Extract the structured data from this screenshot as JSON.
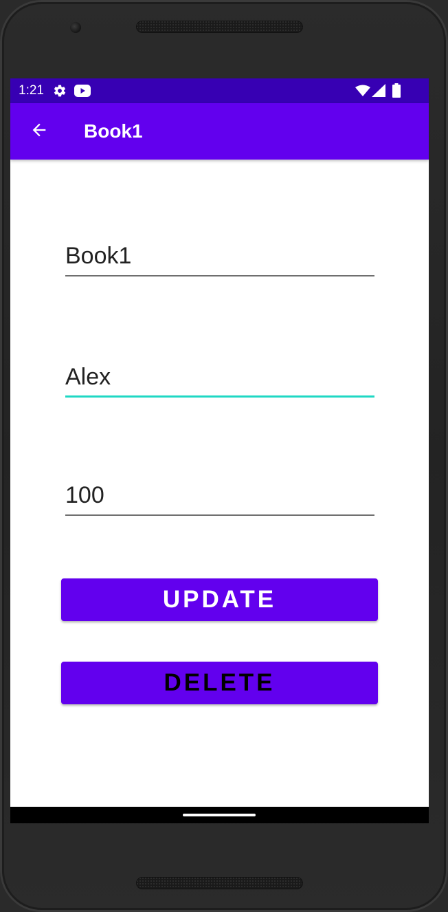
{
  "status_bar": {
    "time": "1:21",
    "icons": [
      "settings-icon",
      "youtube-icon",
      "wifi-icon",
      "signal-icon",
      "battery-icon"
    ],
    "background": "#3700b3"
  },
  "app_bar": {
    "title": "Book1",
    "back_icon": "arrow-back-icon",
    "background": "#6200ee"
  },
  "form": {
    "title_field": {
      "value": "Book1"
    },
    "author_field": {
      "value": "Alex",
      "focused": true,
      "focus_color": "#1fd8c4"
    },
    "pages_field": {
      "value": "100"
    }
  },
  "buttons": {
    "update_label": "UPDATE",
    "update_text_color": "#ffffff",
    "delete_label": "DELETE",
    "delete_text_color": "#000000",
    "background": "#6200ee"
  }
}
